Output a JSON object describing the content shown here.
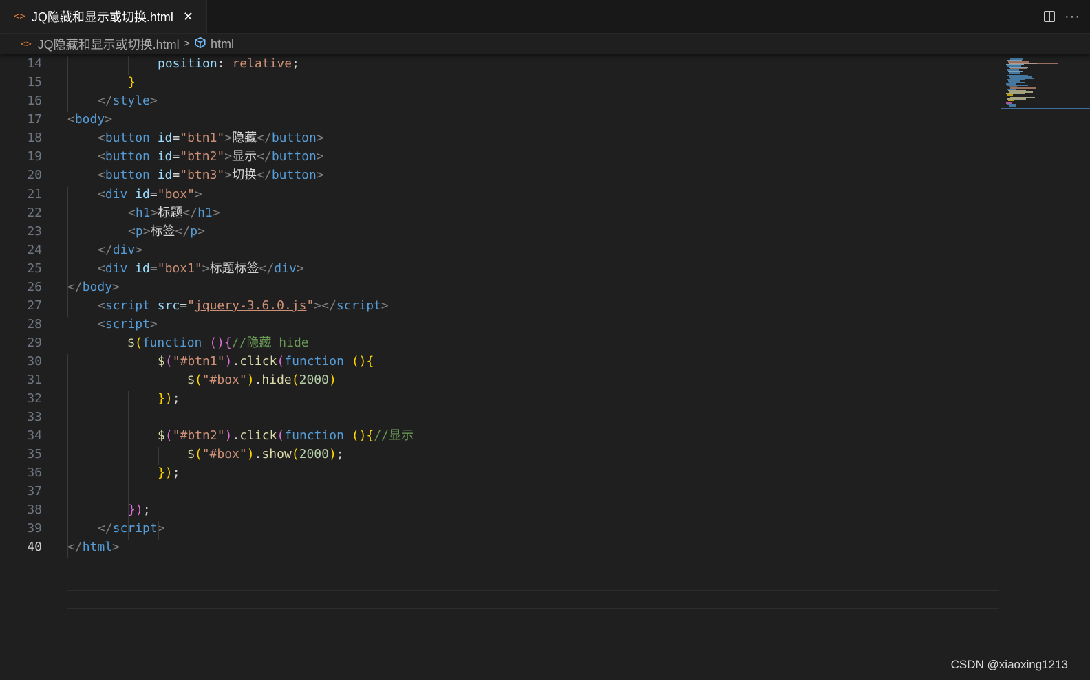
{
  "tab": {
    "file_name": "JQ隐藏和显示或切换.html",
    "file_icon": "html-file-icon",
    "close_glyph": "✕"
  },
  "actions": {
    "split_icon": "split-editor-icon",
    "more_glyph": "···"
  },
  "breadcrumb": {
    "file_name": "JQ隐藏和显示或切换.html",
    "separator": ">",
    "symbol_label": "html",
    "symbol_icon": "cube-icon"
  },
  "editor": {
    "current_line": "40",
    "lines": [
      {
        "n": "14",
        "tokens": [
          [
            "a",
            "position"
          ],
          [
            "w",
            ": "
          ],
          [
            "s",
            "relative"
          ],
          [
            "w",
            ";"
          ]
        ]
      },
      {
        "n": "15",
        "tokens": [
          [
            "y",
            "}"
          ]
        ]
      },
      {
        "n": "16",
        "tokens": [
          [
            "p",
            "</"
          ],
          [
            "t",
            "style"
          ],
          [
            "p",
            ">"
          ]
        ]
      },
      {
        "n": "17",
        "tokens": [
          [
            "p",
            "<"
          ],
          [
            "t",
            "body"
          ],
          [
            "p",
            ">"
          ]
        ]
      },
      {
        "n": "18",
        "tokens": [
          [
            "p",
            "<"
          ],
          [
            "t",
            "button"
          ],
          [
            "w",
            " "
          ],
          [
            "a",
            "id"
          ],
          [
            "w",
            "="
          ],
          [
            "s",
            "\"btn1\""
          ],
          [
            "p",
            ">"
          ],
          [
            "w",
            "隐藏"
          ],
          [
            "p",
            "</"
          ],
          [
            "t",
            "button"
          ],
          [
            "p",
            ">"
          ]
        ]
      },
      {
        "n": "19",
        "tokens": [
          [
            "p",
            "<"
          ],
          [
            "t",
            "button"
          ],
          [
            "w",
            " "
          ],
          [
            "a",
            "id"
          ],
          [
            "w",
            "="
          ],
          [
            "s",
            "\"btn2\""
          ],
          [
            "p",
            ">"
          ],
          [
            "w",
            "显示"
          ],
          [
            "p",
            "</"
          ],
          [
            "t",
            "button"
          ],
          [
            "p",
            ">"
          ]
        ]
      },
      {
        "n": "20",
        "tokens": [
          [
            "p",
            "<"
          ],
          [
            "t",
            "button"
          ],
          [
            "w",
            " "
          ],
          [
            "a",
            "id"
          ],
          [
            "w",
            "="
          ],
          [
            "s",
            "\"btn3\""
          ],
          [
            "p",
            ">"
          ],
          [
            "w",
            "切换"
          ],
          [
            "p",
            "</"
          ],
          [
            "t",
            "button"
          ],
          [
            "p",
            ">"
          ]
        ]
      },
      {
        "n": "21",
        "tokens": [
          [
            "p",
            "<"
          ],
          [
            "t",
            "div"
          ],
          [
            "w",
            " "
          ],
          [
            "a",
            "id"
          ],
          [
            "w",
            "="
          ],
          [
            "s",
            "\"box\""
          ],
          [
            "p",
            ">"
          ]
        ]
      },
      {
        "n": "22",
        "tokens": [
          [
            "p",
            "<"
          ],
          [
            "t",
            "h1"
          ],
          [
            "p",
            ">"
          ],
          [
            "w",
            "标题"
          ],
          [
            "p",
            "</"
          ],
          [
            "t",
            "h1"
          ],
          [
            "p",
            ">"
          ]
        ]
      },
      {
        "n": "23",
        "tokens": [
          [
            "p",
            "<"
          ],
          [
            "t",
            "p"
          ],
          [
            "p",
            ">"
          ],
          [
            "w",
            "标签"
          ],
          [
            "p",
            "</"
          ],
          [
            "t",
            "p"
          ],
          [
            "p",
            ">"
          ]
        ]
      },
      {
        "n": "24",
        "tokens": [
          [
            "p",
            "</"
          ],
          [
            "t",
            "div"
          ],
          [
            "p",
            ">"
          ]
        ]
      },
      {
        "n": "25",
        "tokens": [
          [
            "p",
            "<"
          ],
          [
            "t",
            "div"
          ],
          [
            "w",
            " "
          ],
          [
            "a",
            "id"
          ],
          [
            "w",
            "="
          ],
          [
            "s",
            "\"box1\""
          ],
          [
            "p",
            ">"
          ],
          [
            "w",
            "标题标签"
          ],
          [
            "p",
            "</"
          ],
          [
            "t",
            "div"
          ],
          [
            "p",
            ">"
          ]
        ]
      },
      {
        "n": "26",
        "tokens": [
          [
            "p",
            "</"
          ],
          [
            "t",
            "body"
          ],
          [
            "p",
            ">"
          ]
        ]
      },
      {
        "n": "27",
        "tokens": [
          [
            "p",
            "<"
          ],
          [
            "t",
            "script"
          ],
          [
            "w",
            " "
          ],
          [
            "a",
            "src"
          ],
          [
            "w",
            "="
          ],
          [
            "s",
            "\""
          ],
          [
            "s u",
            "jquery-3.6.0.js"
          ],
          [
            "s",
            "\""
          ],
          [
            "p",
            "></"
          ],
          [
            "t",
            "script"
          ],
          [
            "p",
            ">"
          ]
        ]
      },
      {
        "n": "28",
        "tokens": [
          [
            "p",
            "<"
          ],
          [
            "t",
            "script"
          ],
          [
            "p",
            ">"
          ]
        ]
      },
      {
        "n": "29",
        "tokens": [
          [
            "f",
            "$"
          ],
          [
            "y",
            "("
          ],
          [
            "k",
            "function"
          ],
          [
            "w",
            " "
          ],
          [
            "m",
            "()"
          ],
          [
            "m",
            "{"
          ],
          [
            "c",
            "//隐藏 hide"
          ]
        ]
      },
      {
        "n": "30",
        "tokens": [
          [
            "f",
            "$"
          ],
          [
            "m",
            "("
          ],
          [
            "s",
            "\"#btn1\""
          ],
          [
            "m",
            ")"
          ],
          [
            "w",
            "."
          ],
          [
            "f",
            "click"
          ],
          [
            "m",
            "("
          ],
          [
            "k",
            "function"
          ],
          [
            "w",
            " "
          ],
          [
            "y",
            "()"
          ],
          [
            "y",
            "{"
          ]
        ]
      },
      {
        "n": "31",
        "tokens": [
          [
            "f",
            "$"
          ],
          [
            "y",
            "("
          ],
          [
            "s",
            "\"#box\""
          ],
          [
            "y",
            ")"
          ],
          [
            "w",
            "."
          ],
          [
            "f",
            "hide"
          ],
          [
            "y",
            "("
          ],
          [
            "n",
            "2000"
          ],
          [
            "y",
            ")"
          ]
        ]
      },
      {
        "n": "32",
        "tokens": [
          [
            "y",
            "})"
          ],
          [
            "w",
            ";"
          ]
        ]
      },
      {
        "n": "33",
        "tokens": []
      },
      {
        "n": "34",
        "tokens": [
          [
            "f",
            "$"
          ],
          [
            "m",
            "("
          ],
          [
            "s",
            "\"#btn2\""
          ],
          [
            "m",
            ")"
          ],
          [
            "w",
            "."
          ],
          [
            "f",
            "click"
          ],
          [
            "m",
            "("
          ],
          [
            "k",
            "function"
          ],
          [
            "w",
            " "
          ],
          [
            "y",
            "()"
          ],
          [
            "y",
            "{"
          ],
          [
            "c",
            "//显示"
          ]
        ]
      },
      {
        "n": "35",
        "tokens": [
          [
            "f",
            "$"
          ],
          [
            "y",
            "("
          ],
          [
            "s",
            "\"#box\""
          ],
          [
            "y",
            ")"
          ],
          [
            "w",
            "."
          ],
          [
            "f",
            "show"
          ],
          [
            "y",
            "("
          ],
          [
            "n",
            "2000"
          ],
          [
            "y",
            ")"
          ],
          [
            "w",
            ";"
          ]
        ]
      },
      {
        "n": "36",
        "tokens": [
          [
            "y",
            "})"
          ],
          [
            "w",
            ";"
          ]
        ]
      },
      {
        "n": "37",
        "tokens": []
      },
      {
        "n": "38",
        "tokens": [
          [
            "m",
            "})"
          ],
          [
            "w",
            ";"
          ]
        ]
      },
      {
        "n": "39",
        "tokens": [
          [
            "p",
            "</"
          ],
          [
            "t",
            "script"
          ],
          [
            "p",
            ">"
          ]
        ]
      },
      {
        "n": "40",
        "tokens": [
          [
            "p",
            "</"
          ],
          [
            "t",
            "html"
          ],
          [
            "p",
            ">"
          ]
        ]
      }
    ]
  },
  "watermark": "CSDN @xiaoxing1213"
}
